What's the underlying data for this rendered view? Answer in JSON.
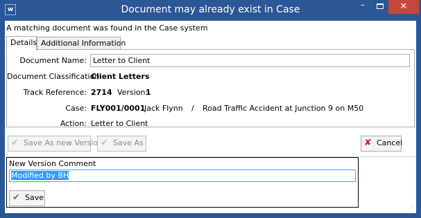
{
  "window": {
    "app_icon": "word-icon",
    "app_icon_text": "w",
    "title": "Document may already exist in Case",
    "min_glyph": "–",
    "close_glyph": "✕"
  },
  "message": "A matching document was found in the Case system",
  "tabs": [
    {
      "label": "Details",
      "active": true
    },
    {
      "label": "Additional Information",
      "active": false
    }
  ],
  "details": {
    "document_name_label": "Document Name:",
    "document_name_value": "Letter to Client",
    "classification_label": "Document Classification:",
    "classification_value": "Client Letters",
    "track_label": "Track Reference:",
    "track_value": "2714",
    "version_label": "Version:",
    "version_value": "1",
    "case_label": "Case:",
    "case_code": "FLY001/0001",
    "case_client": "Jack Flynn",
    "case_sep": "/",
    "case_desc": "Road Traffic Accident at Junction 9 on M50",
    "action_label": "Action:",
    "action_value": "Letter to Client"
  },
  "buttons": {
    "save_new_version": "Save As new Version",
    "save_as": "Save As",
    "cancel": "Cancel",
    "save": "Save"
  },
  "comment": {
    "label": "New Version Comment",
    "value": "Modified by BH"
  },
  "icons": {
    "check": "✔",
    "x": "✘"
  },
  "colors": {
    "titlebar": "#2b5797",
    "close_button": "#c7453b",
    "selection": "#3399ff"
  }
}
